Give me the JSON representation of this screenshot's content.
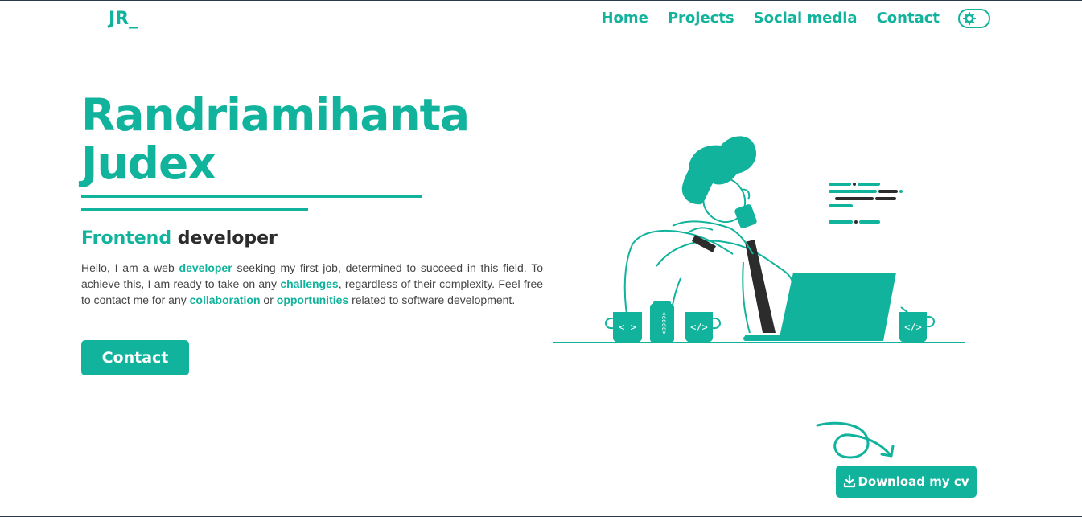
{
  "logo": "JR_",
  "nav": {
    "items": [
      {
        "label": "Home"
      },
      {
        "label": "Projects"
      },
      {
        "label": "Social media"
      },
      {
        "label": "Contact"
      }
    ],
    "theme_toggle_icon": "gear-icon"
  },
  "hero": {
    "name_line1": "Randriamihanta",
    "name_line2": "Judex",
    "role_accent": "Frontend",
    "role_rest": "developer",
    "bio": {
      "p1": "Hello, I am a web ",
      "h1": "developer",
      "p2": " seeking my first job, determined to succeed in this field. To achieve this, I am ready to take on any ",
      "h2": "challenges",
      "p3": ", regardless of their complexity. Feel free to contact me for any ",
      "h3": "collaboration",
      "p4": " or ",
      "h4": "opportunities",
      "p5": " related to software development."
    },
    "contact_button": "Contact"
  },
  "download": {
    "label": "Download my cv",
    "icon": "download-icon"
  },
  "illustration": {
    "cup1_code": "< >",
    "can_code": "<code>",
    "cup2_code": "</>",
    "cup3_code": "</>"
  },
  "colors": {
    "accent": "#12b39c",
    "dark": "#2c2c2c"
  }
}
